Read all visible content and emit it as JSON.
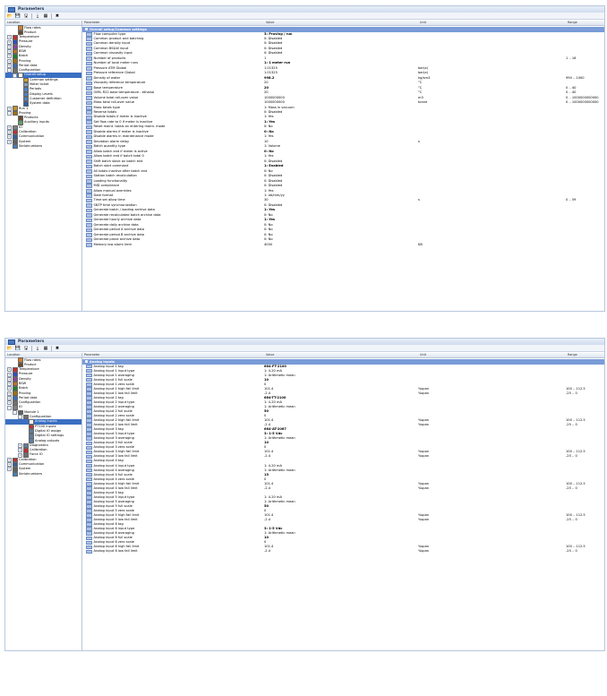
{
  "windows": [
    {
      "title": "Parameters",
      "toolbar": [
        "open-icon",
        "save-icon",
        "save-as-icon",
        "download-icon",
        "grid-icon",
        "tools-icon"
      ],
      "tree_header": "Location",
      "columns": {
        "parameter": "Parameter",
        "value": "Value",
        "unit": "Unit",
        "range": "Range"
      },
      "tree": [
        {
          "label": "Flow rates",
          "level": 1,
          "expander": "",
          "icon": "#d08030"
        },
        {
          "label": "Product",
          "level": 1,
          "expander": "",
          "icon": "#6a4a2a"
        },
        {
          "label": "Temperature",
          "level": 0,
          "expander": "+",
          "icon": "#c03030"
        },
        {
          "label": "Pressure",
          "level": 0,
          "expander": "+",
          "icon": "#3050c0"
        },
        {
          "label": "Density",
          "level": 0,
          "expander": "+",
          "icon": "#9040a0"
        },
        {
          "label": "BSW",
          "level": 0,
          "expander": "+",
          "icon": "#c07020"
        },
        {
          "label": "Batch",
          "level": 0,
          "expander": "+",
          "icon": "#208030"
        },
        {
          "label": "Proving",
          "level": 0,
          "expander": "+",
          "icon": "#a07010"
        },
        {
          "label": "Period data",
          "level": 0,
          "expander": "+",
          "icon": "#3070c0"
        },
        {
          "label": "Configuration",
          "level": 0,
          "expander": "-",
          "icon": "#707070"
        },
        {
          "label": "Overall setup",
          "level": 1,
          "expander": "-",
          "icon": "#ffffff",
          "selected": true
        },
        {
          "label": "Common settings",
          "level": 2,
          "expander": "",
          "icon": "#d0a030"
        },
        {
          "label": "Meter ticket",
          "level": 2,
          "expander": "",
          "icon": "#8aa0c0"
        },
        {
          "label": "Periods",
          "level": 2,
          "expander": "",
          "icon": "#5080c0"
        },
        {
          "label": "Display Levels",
          "level": 2,
          "expander": "",
          "icon": "#5080c0"
        },
        {
          "label": "Customer definition",
          "level": 2,
          "expander": "",
          "icon": "#5080c0"
        },
        {
          "label": "System data",
          "level": 2,
          "expander": "",
          "icon": "#3060a0"
        },
        {
          "label": "Run 1",
          "level": 0,
          "expander": "+",
          "icon": "#c09020"
        },
        {
          "label": "Proving",
          "level": 0,
          "expander": "-",
          "icon": "#a07010"
        },
        {
          "label": "Products",
          "level": 1,
          "expander": "",
          "icon": "#6a4a2a"
        },
        {
          "label": "Auxiliary inputs",
          "level": 1,
          "expander": "",
          "icon": "#60a060"
        },
        {
          "label": "IO",
          "level": 0,
          "expander": "+",
          "icon": "#808080"
        },
        {
          "label": "Calibration",
          "level": 0,
          "expander": "+",
          "icon": "#c03030"
        },
        {
          "label": "Communication",
          "level": 0,
          "expander": "+",
          "icon": "#3060a0"
        },
        {
          "label": "System",
          "level": 0,
          "expander": "+",
          "icon": "#606060"
        },
        {
          "label": "Serialnumbers",
          "level": 0,
          "expander": "",
          "icon": "#4080c0"
        }
      ],
      "section": "Overall setup/Common settings",
      "rows": [
        {
          "p": "Flow computer type",
          "v": "3: Proving / run",
          "u": "",
          "r": "",
          "b": true
        },
        {
          "p": "Common product and batching",
          "v": "0: Disabled",
          "u": "",
          "r": ""
        },
        {
          "p": "Common density input",
          "v": "0: Disabled",
          "u": "",
          "r": ""
        },
        {
          "p": "Common BS&W input",
          "v": "0: Disabled",
          "u": "",
          "r": ""
        },
        {
          "p": "Common viscosity input",
          "v": "0: Disabled",
          "u": "",
          "r": ""
        },
        {
          "p": "Number of products",
          "v": "1",
          "u": "",
          "r": "1 .. 16"
        },
        {
          "p": "Number of local meter runs",
          "v": "1: 1 meter run",
          "u": "",
          "r": "",
          "b": true
        },
        {
          "p": "Pressure ATM Global",
          "v": "1.01325",
          "u": "bar(a)",
          "r": ""
        },
        {
          "p": "Pressure reference Global",
          "v": "1.01325",
          "u": "bar(a)",
          "r": ""
        },
        {
          "p": "Density of water",
          "v": "998.2",
          "u": "kg/sm3",
          "r": "990 .. 1000",
          "b": true
        },
        {
          "p": "Viscosity reference temperature",
          "v": "20",
          "u": "°C",
          "r": ""
        },
        {
          "p": "Base temperature",
          "v": "20",
          "u": "°C",
          "r": "0 .. 40",
          "b": true
        },
        {
          "p": "OIML R22 base temperature - ethanol",
          "v": "20",
          "u": "°C",
          "r": "0 .. 40"
        },
        {
          "p": "Volume total roll-over value",
          "v": "1000000000",
          "u": "m3",
          "r": "0 .. 1000000000000"
        },
        {
          "p": "Mass total roll-over value",
          "v": "1000000000",
          "u": "tonne",
          "r": "0 .. 1000000000000"
        },
        {
          "p": "Mass totals type",
          "v": "1: Mass in vacuum",
          "u": "",
          "r": ""
        },
        {
          "p": "Reverse totals",
          "v": "0: Disabled",
          "u": "",
          "r": ""
        },
        {
          "p": "Disable totals if meter is inactive",
          "v": "1: Yes",
          "u": "",
          "r": ""
        },
        {
          "p": "Set flow rate to 0 if meter is inactive",
          "v": "1: Yes",
          "u": "",
          "r": "",
          "b": true
        },
        {
          "p": "Reset maint. totals on entering maint. mode",
          "v": "0: No",
          "u": "",
          "r": ""
        },
        {
          "p": "Disable alarms if meter is inactive",
          "v": "0: No",
          "u": "",
          "r": "",
          "b": true
        },
        {
          "p": "Disable alarms in maintenance mode",
          "v": "1: Yes",
          "u": "",
          "r": ""
        },
        {
          "p": "Deviation alarm delay",
          "v": "10",
          "u": "s",
          "r": ""
        },
        {
          "p": "Batch quantity type",
          "v": "1: Volume",
          "u": "",
          "r": ""
        },
        {
          "p": "Allow batch end if meter is active",
          "v": "0: No",
          "u": "",
          "r": "",
          "b": true
        },
        {
          "p": "Allow batch end if batch total 0",
          "v": "1: Yes",
          "u": "",
          "r": ""
        },
        {
          "p": "Shift batch stack on batch end",
          "v": "0: Disabled",
          "u": "",
          "r": ""
        },
        {
          "p": "Batch start command",
          "v": "1: Enabled",
          "u": "",
          "r": "",
          "b": true
        },
        {
          "p": "All totals inactive after batch end",
          "v": "0: No",
          "u": "",
          "r": ""
        },
        {
          "p": "Station batch recalculation",
          "v": "0: Disabled",
          "u": "",
          "r": ""
        },
        {
          "p": "Loading functionality",
          "v": "0: Disabled",
          "u": "",
          "r": ""
        },
        {
          "p": "MID compliance",
          "v": "0: Disabled",
          "u": "",
          "r": ""
        },
        {
          "p": "Allow manual overrides",
          "v": "1: Yes",
          "u": "",
          "r": ""
        },
        {
          "p": "Date format",
          "v": "1: dd/mm/yy",
          "u": "",
          "r": ""
        },
        {
          "p": "Time set allow time",
          "v": "30",
          "u": "s",
          "r": "0 .. 59"
        },
        {
          "p": "SNTP time synchronization",
          "v": "0: Disabled",
          "u": "",
          "r": ""
        },
        {
          "p": "Generate batch / loading archive data",
          "v": "1: Yes",
          "u": "",
          "r": "",
          "b": true
        },
        {
          "p": "Generate recalculated batch archive data",
          "v": "0: No",
          "u": "",
          "r": ""
        },
        {
          "p": "Generate hourly archive data",
          "v": "1: Yes",
          "u": "",
          "r": "",
          "b": true
        },
        {
          "p": "Generate daily archive data",
          "v": "0: No",
          "u": "",
          "r": ""
        },
        {
          "p": "Generate period A archive data",
          "v": "0: No",
          "u": "",
          "r": ""
        },
        {
          "p": "Generate period B archive data",
          "v": "0: No",
          "u": "",
          "r": ""
        },
        {
          "p": "Generate prove archive data",
          "v": "0: No",
          "u": "",
          "r": ""
        },
        {
          "p": "Memory low alarm limit",
          "v": "4000",
          "u": "KB",
          "r": ""
        }
      ]
    },
    {
      "title": "Parameters",
      "toolbar": [
        "open-icon",
        "save-icon",
        "save-as-icon",
        "download-icon",
        "grid-icon",
        "tools-icon"
      ],
      "tree_header": "Location",
      "columns": {
        "parameter": "Parameter",
        "value": "Value",
        "unit": "Unit",
        "range": "Range"
      },
      "tree": [
        {
          "label": "Flow rates",
          "level": 1,
          "expander": "",
          "icon": "#d08030"
        },
        {
          "label": "Product",
          "level": 1,
          "expander": "",
          "icon": "#6a4a2a"
        },
        {
          "label": "Temperature",
          "level": 0,
          "expander": "+",
          "icon": "#c03030"
        },
        {
          "label": "Pressure",
          "level": 0,
          "expander": "+",
          "icon": "#3050c0"
        },
        {
          "label": "Density",
          "level": 0,
          "expander": "+",
          "icon": "#9040a0"
        },
        {
          "label": "BSW",
          "level": 0,
          "expander": "+",
          "icon": "#c07020"
        },
        {
          "label": "Batch",
          "level": 0,
          "expander": "+",
          "icon": "#208030"
        },
        {
          "label": "Proving",
          "level": 0,
          "expander": "+",
          "icon": "#a07010"
        },
        {
          "label": "Period data",
          "level": 0,
          "expander": "+",
          "icon": "#3070c0"
        },
        {
          "label": "Configuration",
          "level": 0,
          "expander": "+",
          "icon": "#707070"
        },
        {
          "label": "IO",
          "level": 0,
          "expander": "-",
          "icon": "#808080"
        },
        {
          "label": "Module 1",
          "level": 1,
          "expander": "-",
          "icon": "#606060"
        },
        {
          "label": "Configuration",
          "level": 2,
          "expander": "-",
          "icon": "#707070"
        },
        {
          "label": "Analog inputs",
          "level": 3,
          "expander": "",
          "icon": "#ffffff",
          "selected": true
        },
        {
          "label": "PT100 inputs",
          "level": 3,
          "expander": "",
          "icon": "#c03030"
        },
        {
          "label": "Digital IO assign",
          "level": 3,
          "expander": "",
          "icon": "#6080a0"
        },
        {
          "label": "Digital IO settings",
          "level": 3,
          "expander": "",
          "icon": "#6080a0"
        },
        {
          "label": "Analog outputs",
          "level": 3,
          "expander": "",
          "icon": "#6080a0"
        },
        {
          "label": "Diagnostics",
          "level": 2,
          "expander": "+",
          "icon": "#6080a0"
        },
        {
          "label": "Calibration",
          "level": 2,
          "expander": "+",
          "icon": "#c03030"
        },
        {
          "label": "Force IO",
          "level": 2,
          "expander": "+",
          "icon": "#707070"
        },
        {
          "label": "Calibration",
          "level": 0,
          "expander": "+",
          "icon": "#c03030"
        },
        {
          "label": "Communication",
          "level": 0,
          "expander": "+",
          "icon": "#3060a0"
        },
        {
          "label": "System",
          "level": 0,
          "expander": "+",
          "icon": "#606060"
        },
        {
          "label": "Serialnumbers",
          "level": 0,
          "expander": "",
          "icon": "#4080c0"
        }
      ],
      "section": "Analog inputs",
      "rows": [
        {
          "p": "Analog input 1 tag",
          "v": "664-FT-2100",
          "u": "",
          "r": "",
          "b": true
        },
        {
          "p": "Analog input 1 input type",
          "v": "1: 4-20 mA",
          "u": "",
          "r": ""
        },
        {
          "p": "Analog input 1 averaging",
          "v": "1: Arithmetic mean",
          "u": "",
          "r": ""
        },
        {
          "p": "Analog input 1 full scale",
          "v": "10",
          "u": "",
          "r": "",
          "b": true
        },
        {
          "p": "Analog input 1 zero scale",
          "v": "0",
          "u": "",
          "r": ""
        },
        {
          "p": "Analog input 1 high fail limit",
          "v": "101.4",
          "u": "%span",
          "r": "100 .. 112.5"
        },
        {
          "p": "Analog input 1 low fail limit",
          "v": "-2.4",
          "u": "%span",
          "r": "-25 .. 0"
        },
        {
          "p": "Analog input 2 tag",
          "v": "664-TT-2100",
          "u": "",
          "r": "",
          "b": true
        },
        {
          "p": "Analog input 2 input type",
          "v": "1: 4-20 mA",
          "u": "",
          "r": ""
        },
        {
          "p": "Analog input 2 averaging",
          "v": "1: Arithmetic mean",
          "u": "",
          "r": ""
        },
        {
          "p": "Analog input 2 full scale",
          "v": "50",
          "u": "",
          "r": "",
          "b": true
        },
        {
          "p": "Analog input 2 zero scale",
          "v": "0",
          "u": "",
          "r": ""
        },
        {
          "p": "Analog input 2 high fail limit",
          "v": "101.4",
          "u": "%span",
          "r": "100 .. 112.5"
        },
        {
          "p": "Analog input 2 low fail limit",
          "v": "-2.4",
          "u": "%span",
          "r": "-25 .. 0"
        },
        {
          "p": "Analog input 3 tag",
          "v": "664-AT-2067",
          "u": "",
          "r": "",
          "b": true
        },
        {
          "p": "Analog input 3 input type",
          "v": "3: 1-5 Vdc",
          "u": "",
          "r": "",
          "b": true
        },
        {
          "p": "Analog input 3 averaging",
          "v": "1: Arithmetic mean",
          "u": "",
          "r": ""
        },
        {
          "p": "Analog input 3 full scale",
          "v": "10",
          "u": "",
          "r": "",
          "b": true
        },
        {
          "p": "Analog input 3 zero scale",
          "v": "0",
          "u": "",
          "r": ""
        },
        {
          "p": "Analog input 3 high fail limit",
          "v": "101.4",
          "u": "%span",
          "r": "100 .. 112.5"
        },
        {
          "p": "Analog input 3 low fail limit",
          "v": "-2.4",
          "u": "%span",
          "r": "-25 .. 0"
        },
        {
          "p": "Analog input 4 tag",
          "v": "",
          "u": "",
          "r": ""
        },
        {
          "p": "Analog input 4 input type",
          "v": "1: 4-20 mA",
          "u": "",
          "r": ""
        },
        {
          "p": "Analog input 4 averaging",
          "v": "1: Arithmetic mean",
          "u": "",
          "r": ""
        },
        {
          "p": "Analog input 4 full scale",
          "v": "15",
          "u": "",
          "r": "",
          "b": true
        },
        {
          "p": "Analog input 4 zero scale",
          "v": "0",
          "u": "",
          "r": ""
        },
        {
          "p": "Analog input 4 high fail limit",
          "v": "101.4",
          "u": "%span",
          "r": "100 .. 112.5"
        },
        {
          "p": "Analog input 4 low fail limit",
          "v": "-2.4",
          "u": "%span",
          "r": "-25 .. 0"
        },
        {
          "p": "Analog input 5 tag",
          "v": "",
          "u": "",
          "r": ""
        },
        {
          "p": "Analog input 5 input type",
          "v": "1: 4-20 mA",
          "u": "",
          "r": ""
        },
        {
          "p": "Analog input 5 averaging",
          "v": "1: Arithmetic mean",
          "u": "",
          "r": ""
        },
        {
          "p": "Analog input 5 full scale",
          "v": "50",
          "u": "",
          "r": "",
          "b": true
        },
        {
          "p": "Analog input 5 zero scale",
          "v": "0",
          "u": "",
          "r": ""
        },
        {
          "p": "Analog input 5 high fail limit",
          "v": "101.4",
          "u": "%span",
          "r": "100 .. 112.5"
        },
        {
          "p": "Analog input 5 low fail limit",
          "v": "-2.4",
          "u": "%span",
          "r": "-25 .. 0"
        },
        {
          "p": "Analog input 6 tag",
          "v": "",
          "u": "",
          "r": ""
        },
        {
          "p": "Analog input 6 input type",
          "v": "3: 1-5 Vdc",
          "u": "",
          "r": "",
          "b": true
        },
        {
          "p": "Analog input 6 averaging",
          "v": "1: Arithmetic mean",
          "u": "",
          "r": ""
        },
        {
          "p": "Analog input 6 full scale",
          "v": "10",
          "u": "",
          "r": "",
          "b": true
        },
        {
          "p": "Analog input 6 zero scale",
          "v": "0",
          "u": "",
          "r": ""
        },
        {
          "p": "Analog input 6 high fail limit",
          "v": "101.4",
          "u": "%span",
          "r": "100 .. 112.5"
        },
        {
          "p": "Analog input 6 low fail limit",
          "v": "-2.4",
          "u": "%span",
          "r": "-25 .. 0"
        }
      ]
    }
  ]
}
